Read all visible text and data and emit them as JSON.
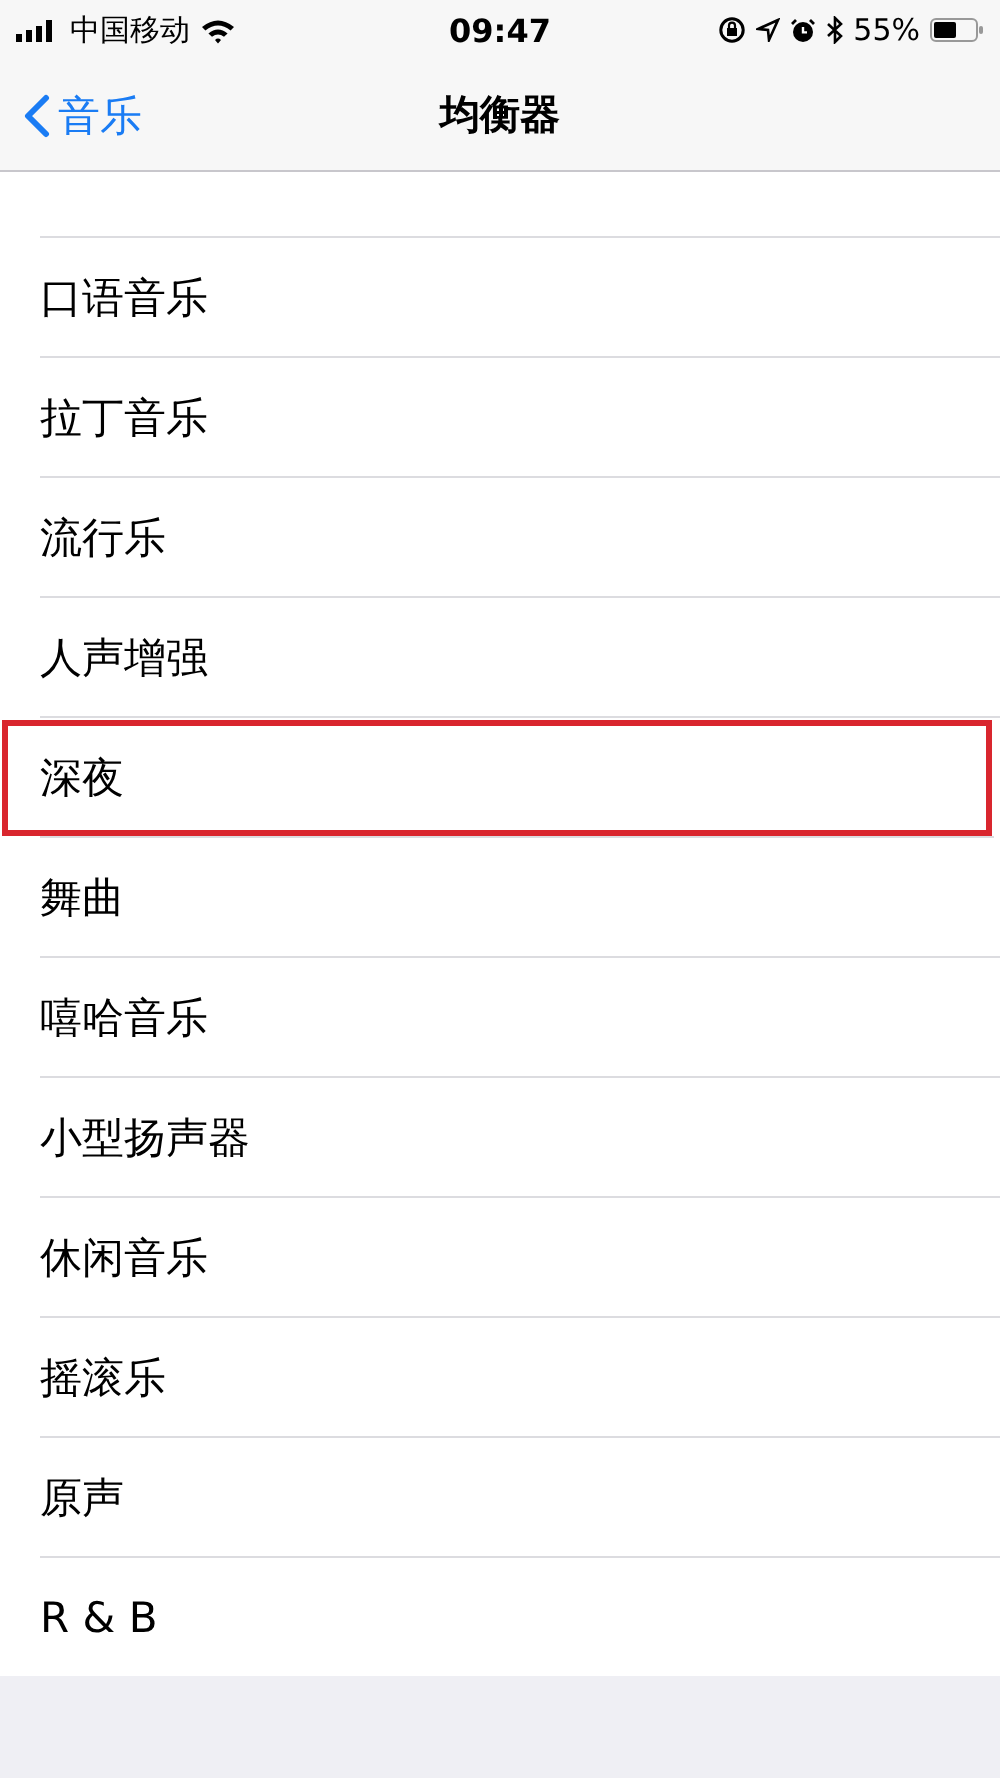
{
  "status_bar": {
    "carrier": "中国移动",
    "time": "09:47",
    "battery": "55%"
  },
  "nav_bar": {
    "back": "音乐",
    "title": "均衡器"
  },
  "items": [
    {
      "label": "口语音乐",
      "highlighted": false
    },
    {
      "label": "拉丁音乐",
      "highlighted": false
    },
    {
      "label": "流行乐",
      "highlighted": false
    },
    {
      "label": "人声增强",
      "highlighted": false
    },
    {
      "label": "深夜",
      "highlighted": true
    },
    {
      "label": "舞曲",
      "highlighted": false
    },
    {
      "label": "嘻哈音乐",
      "highlighted": false
    },
    {
      "label": "小型扬声器",
      "highlighted": false
    },
    {
      "label": "休闲音乐",
      "highlighted": false
    },
    {
      "label": "摇滚乐",
      "highlighted": false
    },
    {
      "label": "原声",
      "highlighted": false
    },
    {
      "label": "R & B",
      "highlighted": false
    }
  ]
}
